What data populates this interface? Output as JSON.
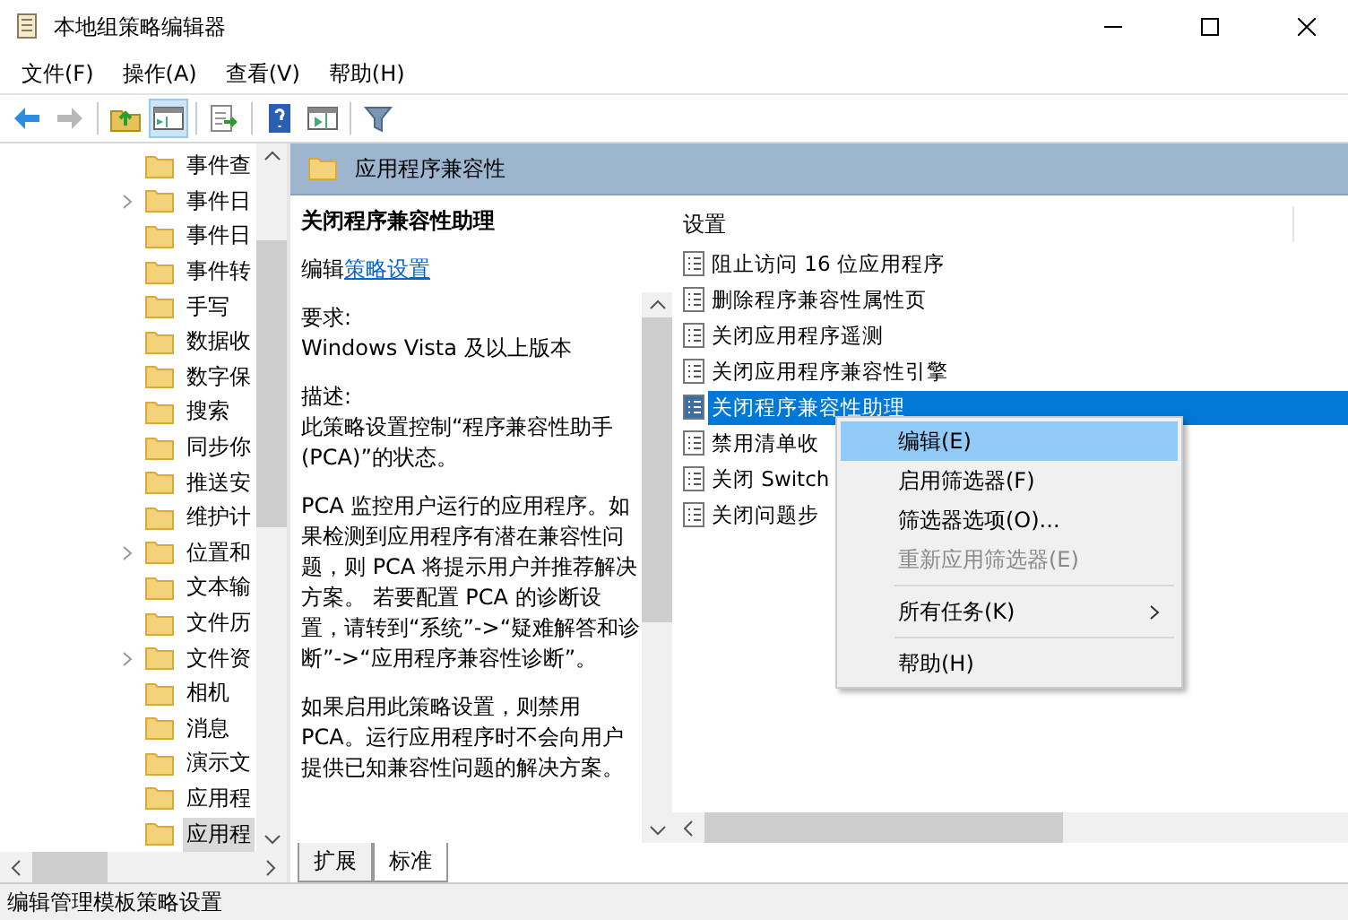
{
  "window": {
    "title": "本地组策略编辑器"
  },
  "menu": [
    "文件(F)",
    "操作(A)",
    "查看(V)",
    "帮助(H)"
  ],
  "toolbar": [
    {
      "kind": "back",
      "disabled": false,
      "on": false
    },
    {
      "kind": "forward",
      "disabled": true,
      "on": false
    },
    {
      "kind": "up",
      "disabled": false,
      "on": false
    },
    {
      "kind": "tree",
      "disabled": false,
      "on": true
    },
    {
      "kind": "export",
      "disabled": false,
      "on": false
    },
    {
      "kind": "help",
      "disabled": false,
      "on": false
    },
    {
      "kind": "pane",
      "disabled": false,
      "on": false
    },
    {
      "kind": "filter",
      "disabled": false,
      "on": false
    }
  ],
  "tree": {
    "items": [
      {
        "label": "事件查",
        "expandable": false,
        "selected": false
      },
      {
        "label": "事件日",
        "expandable": true,
        "selected": false
      },
      {
        "label": "事件日",
        "expandable": false,
        "selected": false
      },
      {
        "label": "事件转",
        "expandable": false,
        "selected": false
      },
      {
        "label": "手写",
        "expandable": false,
        "selected": false
      },
      {
        "label": "数据收",
        "expandable": false,
        "selected": false
      },
      {
        "label": "数字保",
        "expandable": false,
        "selected": false
      },
      {
        "label": "搜索",
        "expandable": false,
        "selected": false
      },
      {
        "label": "同步你",
        "expandable": false,
        "selected": false
      },
      {
        "label": "推送安",
        "expandable": false,
        "selected": false
      },
      {
        "label": "维护计",
        "expandable": false,
        "selected": false
      },
      {
        "label": "位置和",
        "expandable": true,
        "selected": false
      },
      {
        "label": "文本输",
        "expandable": false,
        "selected": false
      },
      {
        "label": "文件历",
        "expandable": false,
        "selected": false
      },
      {
        "label": "文件资",
        "expandable": true,
        "selected": false
      },
      {
        "label": "相机",
        "expandable": false,
        "selected": false
      },
      {
        "label": "消息",
        "expandable": false,
        "selected": false
      },
      {
        "label": "演示文",
        "expandable": false,
        "selected": false
      },
      {
        "label": "应用程",
        "expandable": false,
        "selected": false
      },
      {
        "label": "应用程",
        "expandable": false,
        "selected": true
      }
    ]
  },
  "header": {
    "title": "应用程序兼容性"
  },
  "description": {
    "title": "关闭程序兼容性助理",
    "edit_prefix": "编辑",
    "edit_link": "策略设置",
    "requirements_label": "要求:",
    "requirements": "Windows Vista 及以上版本",
    "description_label": "描述:",
    "paragraphs": [
      "此策略设置控制“程序兼容性助手 (PCA)”的状态。",
      "PCA 监控用户运行的应用程序。如果检测到应用程序有潜在兼容性问题，则 PCA 将提示用户并推荐解决方案。 若要配置 PCA 的诊断设置，请转到“系统”->“疑难解答和诊断”->“应用程序兼容性诊断”。",
      "如果启用此策略设置，则禁用 PCA。运行应用程序时不会向用户提供已知兼容性问题的解决方案。"
    ]
  },
  "settings": {
    "column": "设置",
    "rows": [
      {
        "label": "阻止访问 16 位应用程序",
        "selected": false
      },
      {
        "label": "删除程序兼容性属性页",
        "selected": false
      },
      {
        "label": "关闭应用程序遥测",
        "selected": false
      },
      {
        "label": "关闭应用程序兼容性引擎",
        "selected": false
      },
      {
        "label": "关闭程序兼容性助理",
        "selected": true
      },
      {
        "label": "禁用清单收",
        "selected": false
      },
      {
        "label": "关闭 Switch",
        "selected": false
      },
      {
        "label": "关闭问题步",
        "selected": false
      }
    ]
  },
  "tabs": [
    {
      "label": "扩展",
      "selected": false
    },
    {
      "label": "标准",
      "selected": true
    }
  ],
  "context_menu": [
    {
      "kind": "item",
      "label": "编辑(E)",
      "highlighted": true,
      "disabled": false
    },
    {
      "kind": "item",
      "label": "启用筛选器(F)",
      "highlighted": false,
      "disabled": false
    },
    {
      "kind": "item",
      "label": "筛选器选项(O)...",
      "highlighted": false,
      "disabled": false
    },
    {
      "kind": "item",
      "label": "重新应用筛选器(E)",
      "highlighted": false,
      "disabled": true
    },
    {
      "kind": "separator"
    },
    {
      "kind": "submenu",
      "label": "所有任务(K)",
      "highlighted": false,
      "disabled": false
    },
    {
      "kind": "separator"
    },
    {
      "kind": "item",
      "label": "帮助(H)",
      "highlighted": false,
      "disabled": false
    }
  ],
  "status_bar": "编辑管理模板策略设置"
}
